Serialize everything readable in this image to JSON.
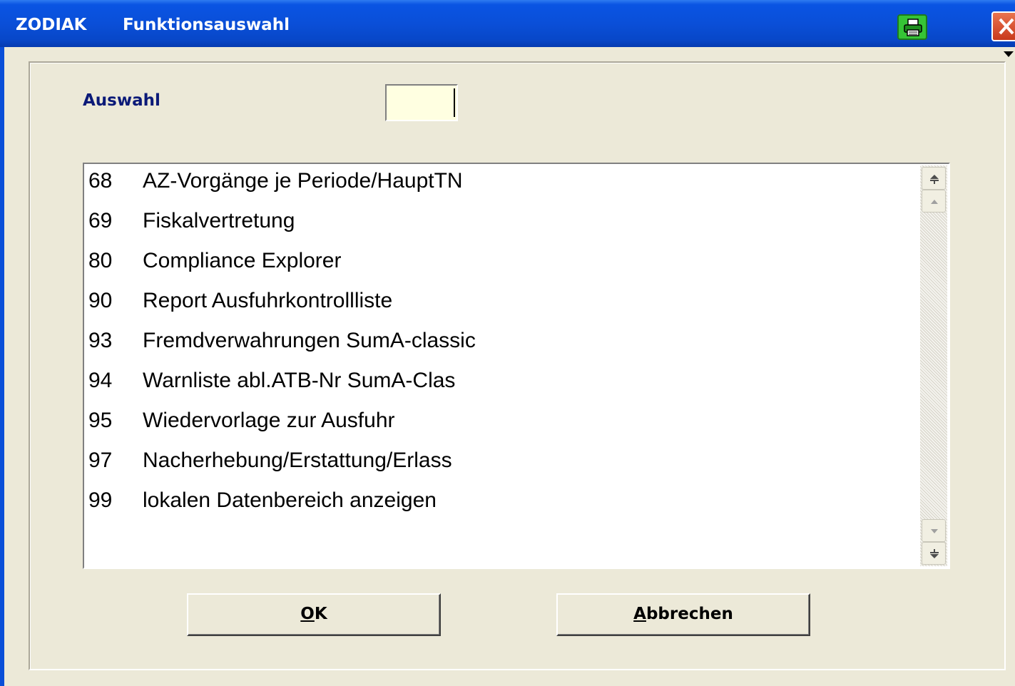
{
  "window": {
    "app_name": "ZODIAK",
    "title": "Funktionsauswahl",
    "title_bar_color": "#0a4fd8"
  },
  "icons": {
    "print": "printer-icon",
    "close": "close-icon"
  },
  "form": {
    "auswahl_label": "Auswahl",
    "auswahl_value": ""
  },
  "list": {
    "items": [
      {
        "num": "68",
        "text": "AZ-Vorgänge je Periode/HauptTN"
      },
      {
        "num": "69",
        "text": "Fiskalvertretung"
      },
      {
        "num": "80",
        "text": "Compliance Explorer"
      },
      {
        "num": "90",
        "text": "Report Ausfuhrkontrollliste"
      },
      {
        "num": "93",
        "text": "Fremdverwahrungen SumA-classic"
      },
      {
        "num": "94",
        "text": "Warnliste abl.ATB-Nr SumA-Clas"
      },
      {
        "num": "95",
        "text": "Wiedervorlage zur Ausfuhr"
      },
      {
        "num": "97",
        "text": "Nacherhebung/Erstattung/Erlass"
      },
      {
        "num": "99",
        "text": "lokalen Datenbereich anzeigen"
      }
    ]
  },
  "buttons": {
    "ok_access": "O",
    "ok_rest": "K",
    "cancel_access": "A",
    "cancel_rest": "bbrechen"
  }
}
